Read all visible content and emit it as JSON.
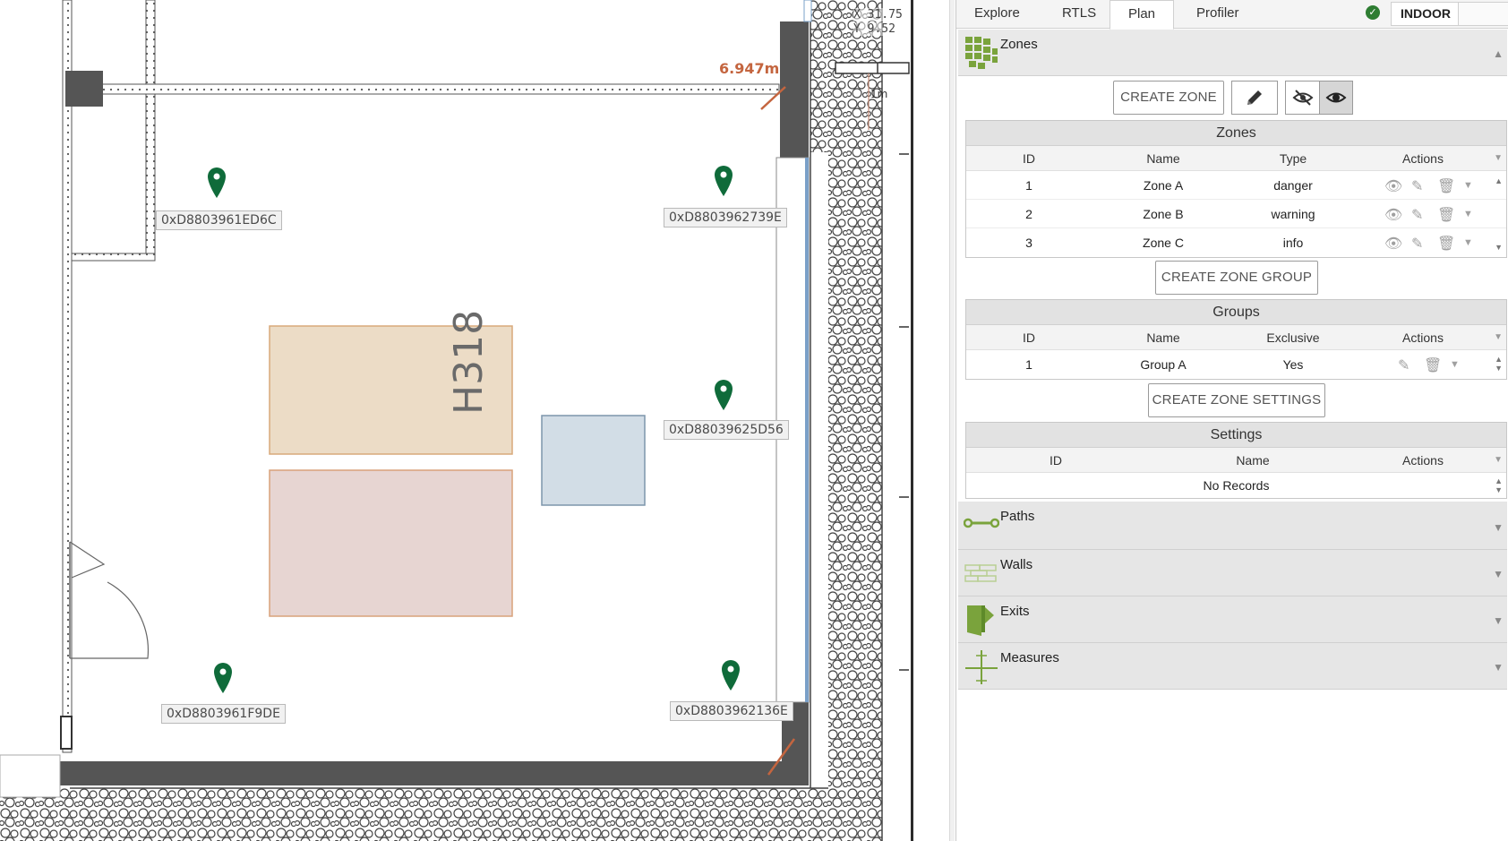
{
  "map": {
    "measurement": "6.947m",
    "scale": "1m",
    "coords": {
      "x": "X 31.75",
      "y": "Y 9.52"
    },
    "room": "H318",
    "tags": [
      {
        "id": "0xD8803961ED6C"
      },
      {
        "id": "0xD8803962739E"
      },
      {
        "id": "0xD88039625D56"
      },
      {
        "id": "0xD8803961F9DE"
      },
      {
        "id": "0xD8803962136E"
      }
    ]
  },
  "tabs": [
    {
      "label": "Explore"
    },
    {
      "label": "RTLS"
    },
    {
      "label": "Plan"
    },
    {
      "label": "Profiler"
    }
  ],
  "active_tab": "Plan",
  "mode": "INDOOR",
  "zones_section": {
    "title": "Zones",
    "create_zone_label": "CREATE ZONE",
    "create_group_label": "CREATE ZONE GROUP",
    "create_settings_label": "CREATE ZONE SETTINGS",
    "zones_grid": {
      "title": "Zones",
      "columns": [
        "ID",
        "Name",
        "Type",
        "Actions"
      ],
      "rows": [
        {
          "id": "1",
          "name": "Zone A",
          "type": "danger"
        },
        {
          "id": "2",
          "name": "Zone B",
          "type": "warning"
        },
        {
          "id": "3",
          "name": "Zone C",
          "type": "info"
        }
      ]
    },
    "groups_grid": {
      "title": "Groups",
      "columns": [
        "ID",
        "Name",
        "Exclusive",
        "Actions"
      ],
      "rows": [
        {
          "id": "1",
          "name": "Group A",
          "exclusive": "Yes"
        }
      ]
    },
    "settings_grid": {
      "title": "Settings",
      "columns": [
        "ID",
        "Name",
        "Actions"
      ],
      "empty_text": "No Records"
    }
  },
  "sections": [
    {
      "title": "Paths",
      "icon": "path-icon"
    },
    {
      "title": "Walls",
      "icon": "wall-icon"
    },
    {
      "title": "Exits",
      "icon": "exit-icon"
    },
    {
      "title": "Measures",
      "icon": "measure-icon"
    }
  ],
  "colors": {
    "accent_green": "#7aa33c",
    "pin_green": "#0f6b3a",
    "measure_red": "#c4653f",
    "zone_tan": "#ecdcc6",
    "zone_pink": "#e7d5d2",
    "zone_blue": "#d2dde6"
  }
}
